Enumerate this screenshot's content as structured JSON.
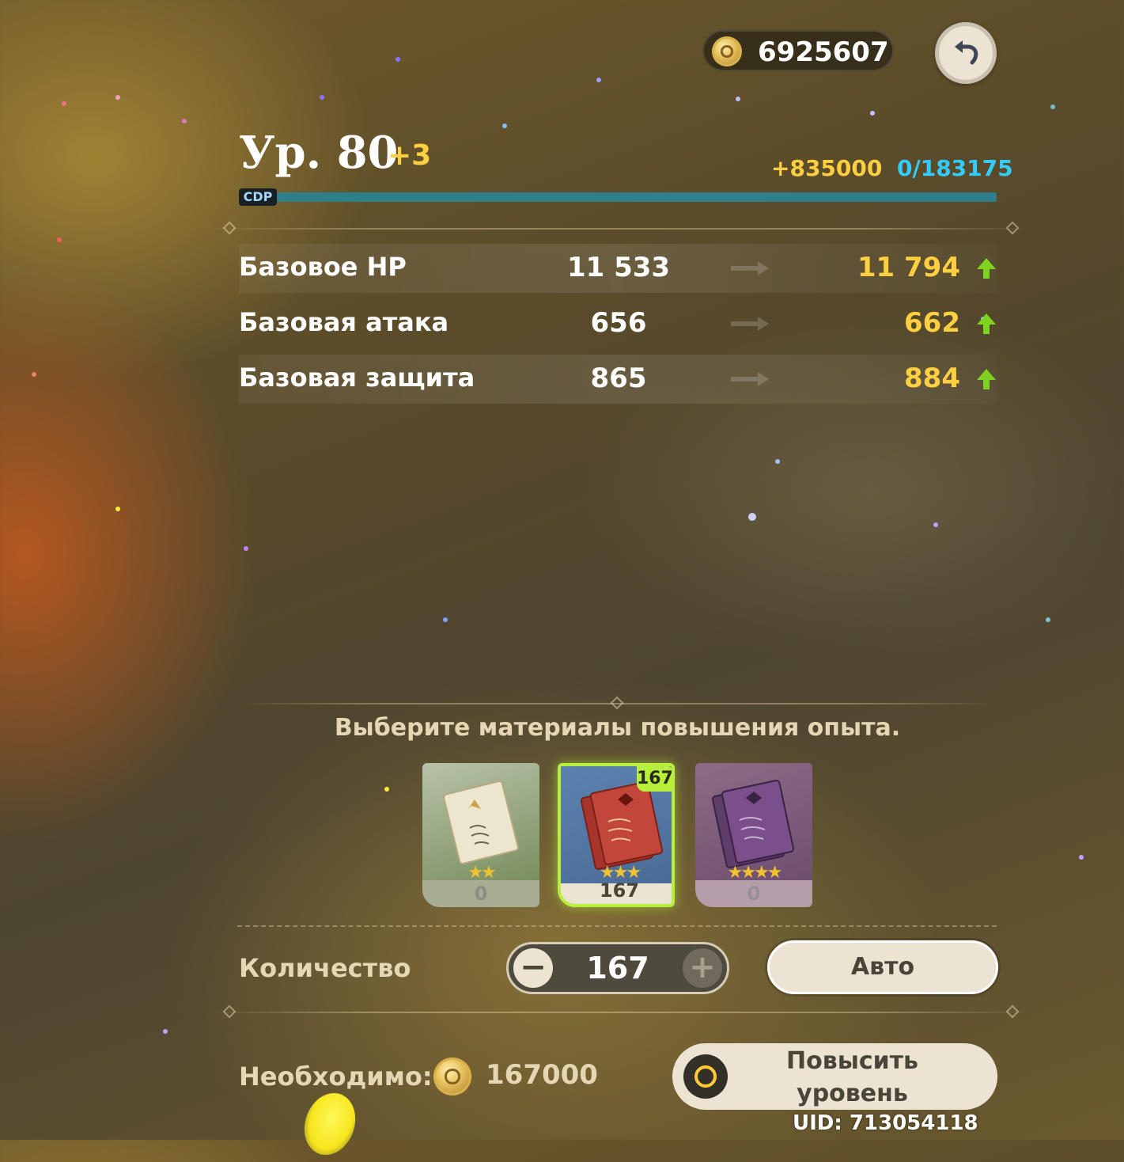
{
  "currency": {
    "mora": "6925607"
  },
  "header": {
    "level": "Ур. 80",
    "level_plus": "+3",
    "exp_gain": "+835000",
    "exp_progress": "0/183175",
    "bar_badge": "CDP",
    "exp_fill_fraction": 1.0
  },
  "stats": [
    {
      "label": "Базовое HP",
      "before": "11 533",
      "after": "11 794"
    },
    {
      "label": "Базовая атака",
      "before": "656",
      "after": "662"
    },
    {
      "label": "Базовая защита",
      "before": "865",
      "after": "884"
    }
  ],
  "materials": {
    "title": "Выберите материалы повышения опыта.",
    "items": [
      {
        "name": "wanderers-advice",
        "stars": "★★",
        "count": "0",
        "selected": false
      },
      {
        "name": "adventurers-experience",
        "stars": "★★★",
        "count": "167",
        "badge": "167",
        "selected": true
      },
      {
        "name": "heros-wit",
        "stars": "★★★★",
        "count": "0",
        "selected": false
      }
    ]
  },
  "quantity": {
    "label": "Количество",
    "value": "167",
    "minus": "−",
    "plus": "+",
    "auto_label": "Авто"
  },
  "cost": {
    "label": "Необходимо:",
    "value": "167000"
  },
  "levelup_label": "Повысить уровень",
  "uid": "UID: 713054118",
  "colors": {
    "gold_text": "#ffcf42",
    "exp_blue": "#33ccff",
    "up_green": "#7ed321",
    "selected_border": "#b7ef3c"
  },
  "icons": [
    "mora-coin-icon",
    "back-arrow-icon",
    "arrow-right-icon",
    "up-arrow-icon",
    "minus-icon",
    "plus-icon",
    "levelup-ring-icon"
  ]
}
